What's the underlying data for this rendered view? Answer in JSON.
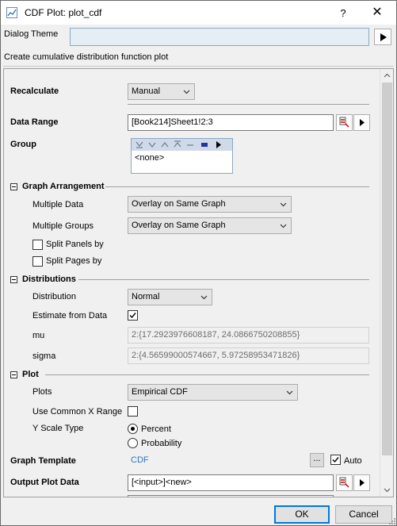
{
  "window": {
    "title": "CDF Plot: plot_cdf",
    "help_label": "?",
    "close_label": "✕"
  },
  "dialog_theme": {
    "label": "Dialog Theme",
    "value": ""
  },
  "description": "Create cumulative distribution function plot",
  "recalculate": {
    "label": "Recalculate",
    "value": "Manual"
  },
  "data_range": {
    "label": "Data Range",
    "value": "[Book214]Sheet1!2:3"
  },
  "group": {
    "label": "Group",
    "value": "<none>"
  },
  "graph_arrangement": {
    "label": "Graph Arrangement",
    "multiple_data_label": "Multiple Data",
    "multiple_data_value": "Overlay on Same Graph",
    "multiple_groups_label": "Multiple Groups",
    "multiple_groups_value": "Overlay on Same Graph",
    "split_panels_label": "Split Panels by",
    "split_panels_checked": false,
    "split_pages_label": "Split Pages by",
    "split_pages_checked": false
  },
  "distributions": {
    "label": "Distributions",
    "distribution_label": "Distribution",
    "distribution_value": "Normal",
    "estimate_label": "Estimate from Data",
    "estimate_checked": true,
    "mu_label": "mu",
    "mu_value": "2:{17.2923976608187, 24.0866750208855}",
    "sigma_label": "sigma",
    "sigma_value": "2:{4.56599000574667, 5.97258953471826}"
  },
  "plot": {
    "label": "Plot",
    "plots_label": "Plots",
    "plots_value": "Empirical CDF",
    "common_x_label": "Use Common X Range",
    "common_x_checked": false,
    "y_scale_label": "Y Scale Type",
    "y_scale_options": [
      "Percent",
      "Probability"
    ],
    "y_scale_selected": "Percent"
  },
  "graph_template": {
    "label": "Graph Template",
    "value": "CDF",
    "browse_label": "...",
    "auto_label": "Auto",
    "auto_checked": true
  },
  "output_plot_data": {
    "label": "Output Plot Data",
    "value": "[<input>]<new>"
  },
  "buttons": {
    "ok": "OK",
    "cancel": "Cancel"
  },
  "colors": {
    "accent": "#0078d7",
    "link": "#2f74c5",
    "theme_field": "#e5eef5"
  }
}
